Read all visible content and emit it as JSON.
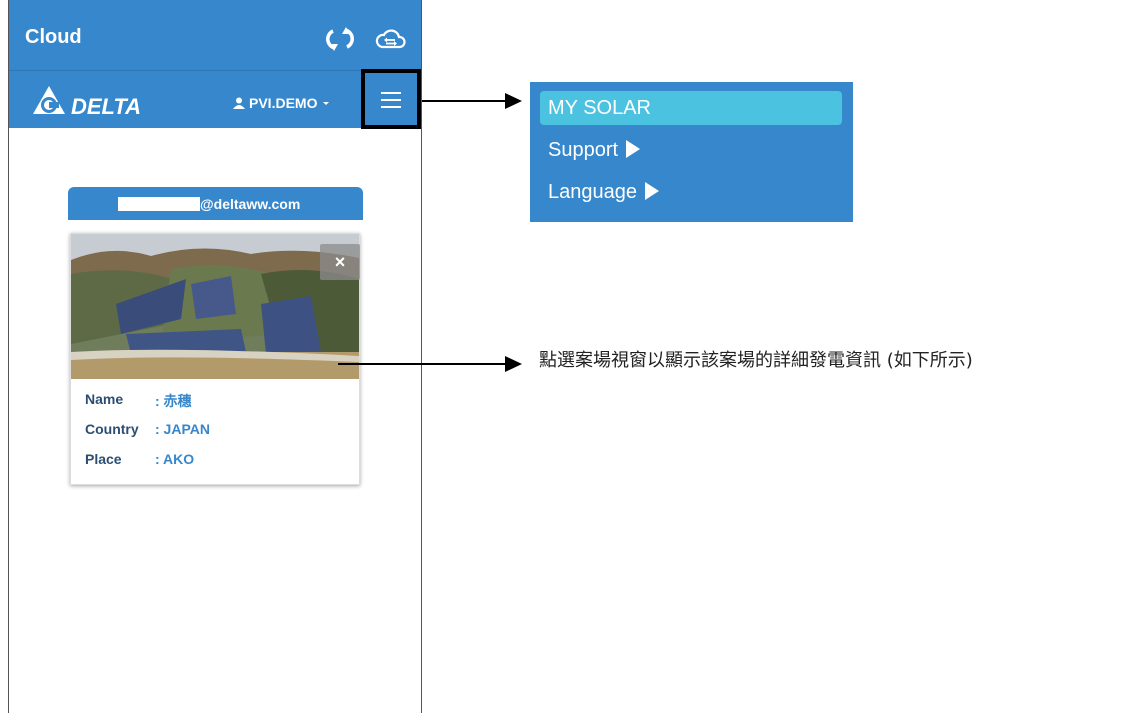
{
  "app": {
    "title": "Cloud",
    "user": "PVI.DEMO"
  },
  "brand": {
    "logo_text": "DELTA"
  },
  "account": {
    "email_suffix": "@deltaww.com"
  },
  "site": {
    "name_label": "Name",
    "name_value": ": 赤穗",
    "country_label": "Country",
    "country_value": ": JAPAN",
    "place_label": "Place",
    "place_value": ": AKO",
    "close": "×"
  },
  "menu": {
    "items": [
      {
        "label": "MY SOLAR",
        "active": true
      },
      {
        "label": "Support",
        "has_submenu": true
      },
      {
        "label": "Language",
        "has_submenu": true
      }
    ]
  },
  "annotation": {
    "text": "點選案場視窗以顯示該案場的詳細發電資訊 (如下所示)"
  },
  "colors": {
    "primary": "#3787cc",
    "active": "#4cc2e1"
  }
}
